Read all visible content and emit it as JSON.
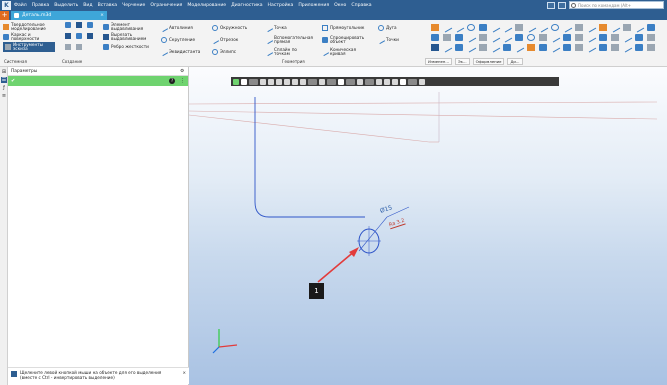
{
  "app": {
    "logo": "K"
  },
  "menu": [
    "Файл",
    "Правка",
    "Выделить",
    "Вид",
    "Вставка",
    "Черчение",
    "Ограничения",
    "Моделирование",
    "Диагностика",
    "Настройка",
    "Приложения",
    "Окно",
    "Справка"
  ],
  "search": {
    "placeholder": "Поиск по командам (Alt+"
  },
  "tab": {
    "title": "Деталь.m3d",
    "close": "×"
  },
  "ribbon": {
    "mode_buttons": [
      {
        "label": "Твердотельное моделирование",
        "icon": "solid-model-icon"
      },
      {
        "label": "Каркас и поверхности",
        "icon": "wireframe-icon"
      },
      {
        "label": "Инструменты эскиза",
        "icon": "sketch-tools-icon"
      }
    ],
    "group_labels": {
      "system": "Системная",
      "create": "Создание",
      "sketch": "Геометрия",
      "tools": "Прочие"
    },
    "create_buttons": [
      "Элемент выдавливания",
      "Вырезать выдавливанием",
      "Ребро жесткости"
    ],
    "sketch_col1": [
      "Автолиния",
      "Скругление",
      "Эквидистанта"
    ],
    "sketch_col2": [
      "Окружность",
      "Отрезок",
      "Эллипс"
    ],
    "sketch_col3": [
      "Точка",
      "Вспомогательная прямая",
      "Сплайн по точкам"
    ],
    "sketch_col4": [
      "Прямоугольник",
      "Спроецировать объект",
      "Коническая кривая"
    ],
    "sketch_col5": [
      "Дуга",
      "Точки"
    ],
    "strip_items": [
      "Изменен...",
      "Эк...",
      "Оформление",
      "Ди..."
    ]
  },
  "panel": {
    "title": "Параметры",
    "status": "Щелкните левой кнопкой мыши на объекте для его выделения (вместе с Ctrl - инвертировать выделение)"
  },
  "canvas": {
    "callout": "1",
    "dimension": "Ø15",
    "roughness": "Ra 3.2"
  },
  "colors": {
    "accent": "#2e5e91",
    "tab": "#3ea6d9",
    "confirm": "#6fd36f"
  }
}
